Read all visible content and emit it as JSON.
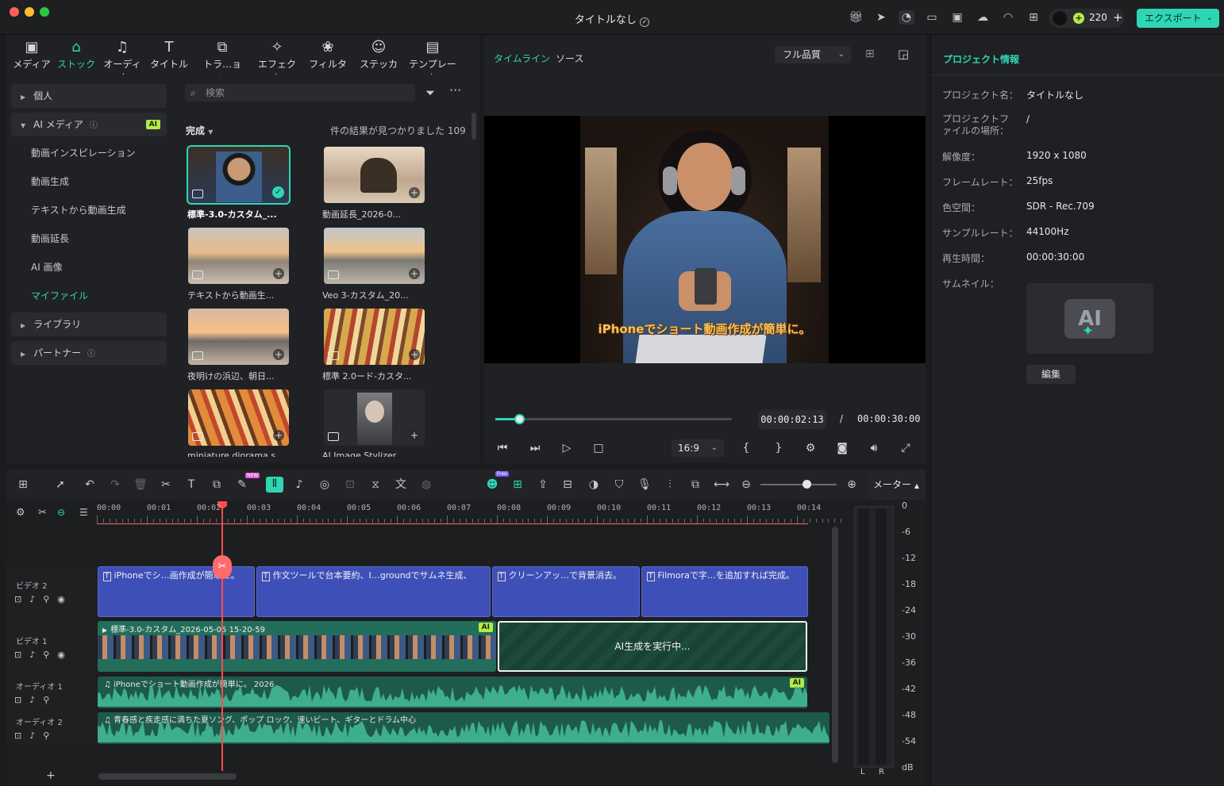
{
  "window": {
    "title": "タイトルなし",
    "credits": "220",
    "export_label": "エクスポート"
  },
  "media_tabs": [
    {
      "label": "メディア",
      "icon": "media-icon",
      "active": false
    },
    {
      "label": "ストック",
      "icon": "stock-icon",
      "active": true
    },
    {
      "label": "オーディオ",
      "icon": "music-icon",
      "active": false
    },
    {
      "label": "タイトル",
      "icon": "text-icon",
      "active": false
    },
    {
      "label": "トラ…ョン",
      "icon": "transition-icon",
      "active": false
    },
    {
      "label": "エフェクト",
      "icon": "effect-icon",
      "active": false
    },
    {
      "label": "フィルター",
      "icon": "filter-icon",
      "active": false
    },
    {
      "label": "ステッカー",
      "icon": "sticker-icon",
      "active": false
    },
    {
      "label": "テンプレート",
      "icon": "template-icon",
      "active": false
    }
  ],
  "sidebar": {
    "personal": "個人",
    "ai_media": "AI メディア",
    "ai_badge": "AI",
    "items": [
      "動画インスピレーション",
      "動画生成",
      "テキストから動画生成",
      "動画延長",
      "AI 画像",
      "マイファイル"
    ],
    "library": "ライブラリ",
    "partner": "パートナー"
  },
  "browser": {
    "search_placeholder": "検索",
    "filter_label": "完成",
    "result_text": "件の結果が見つかりました 109",
    "items": [
      {
        "label": "標準-3.0-カスタム_..."
      },
      {
        "label": "動画延長_2026-0..."
      },
      {
        "label": "テキストから動画生..."
      },
      {
        "label": "Veo 3-カスタム_20..."
      },
      {
        "label": "夜明けの浜辺、朝日..."
      },
      {
        "label": "標準 2.0ード-カスタ..."
      },
      {
        "label": "miniature diorama s..."
      },
      {
        "label": "AI Image Stylizer..."
      }
    ]
  },
  "preview": {
    "tab_timeline": "タイムライン",
    "tab_source": "ソース",
    "quality": "フル品質",
    "caption": "iPhoneでショート動画作成が簡単に。",
    "current_time": "00:00:02:13",
    "separator": "/",
    "total_time": "00:00:30:00",
    "ratio": "16:9",
    "progress": 0.1
  },
  "project_info": {
    "header": "プロジェクト情報",
    "rows": [
      {
        "key": "プロジェクト名：",
        "value": "タイトルなし"
      },
      {
        "key": "プロジェクトファイルの場所：",
        "value": "/"
      },
      {
        "key": "解像度：",
        "value": "1920 x 1080"
      },
      {
        "key": "フレームレート：",
        "value": "25fps"
      },
      {
        "key": "色空間：",
        "value": "SDR - Rec.709"
      },
      {
        "key": "サンプルレート：",
        "value": "44100Hz"
      },
      {
        "key": "再生時間：",
        "value": "00:00:30:00"
      },
      {
        "key": "サムネイル：",
        "value": ""
      }
    ],
    "thumb_text": "AI",
    "edit_label": "編集"
  },
  "timeline": {
    "meter_label": "メーター",
    "ruler": [
      "00:00",
      "00:01",
      "00:02",
      "00:03",
      "00:04",
      "00:05",
      "00:06",
      "00:07",
      "00:08",
      "00:09",
      "00:10",
      "00:11",
      "00:12",
      "00:13",
      "00:14"
    ],
    "tracks": {
      "video2": "ビデオ 2",
      "video1": "ビデオ 1",
      "audio1": "オーディオ 1",
      "audio2": "オーディオ 2"
    },
    "title_clips": [
      "iPhoneでシ…画作成が簡単に。",
      "作文ツールで台本要約、I…groundでサムネ生成、",
      "クリーンアッ…で背景消去。",
      "Filmoraで字…を追加すれば完成。"
    ],
    "video_clip": "標準-3.0-カスタム_2026-05-05 15-20-59",
    "ai_generating": "AI生成を実行中...",
    "ai_badge": "AI",
    "audio1_clip": "iPhoneでショート動画作成が簡単に。 2026",
    "audio2_clip": "青春感と疾走感に満ちた夏ソング、ポップ ロック、速いビート、ギターとドラム中心",
    "meter_scale": [
      "0",
      "-6",
      "-12",
      "-18",
      "-24",
      "-30",
      "-36",
      "-42",
      "-48",
      "-54",
      "dB"
    ],
    "meter_lr": [
      "L",
      "R"
    ],
    "new_badge": "NEW",
    "free_badge": "Free"
  },
  "colors": {
    "accent": "#2fd6b4",
    "title_clip": "#3f4fb8",
    "video_clip": "#236e5a",
    "playhead": "#ff4d4d"
  }
}
